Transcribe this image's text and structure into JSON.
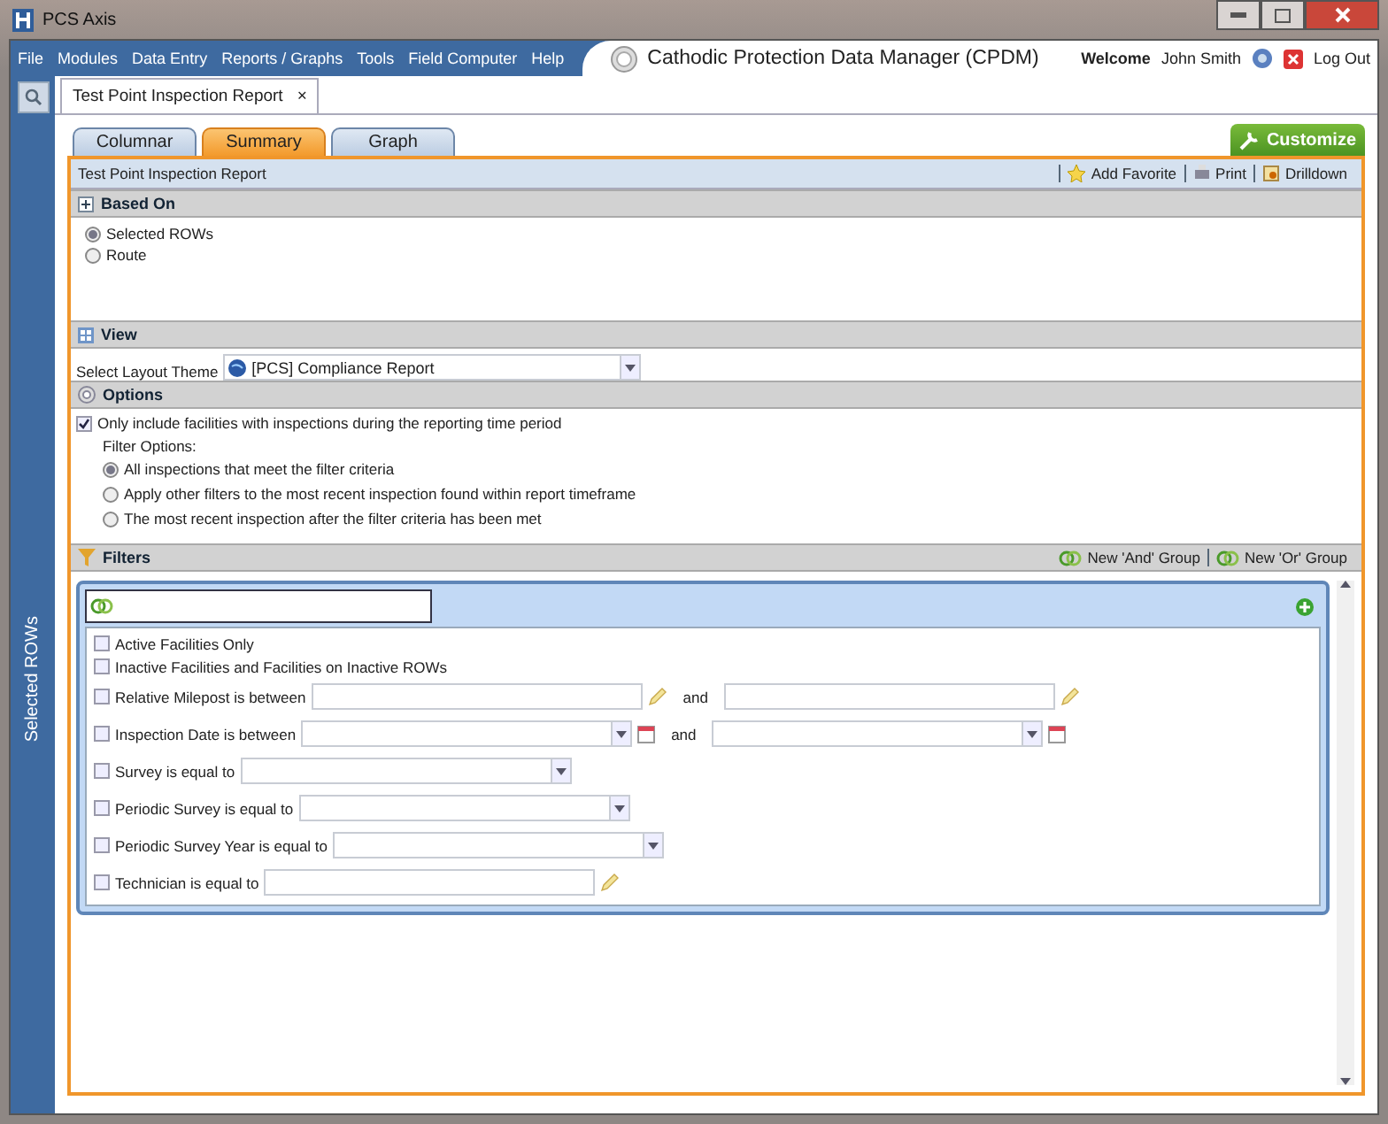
{
  "window": {
    "title": "PCS Axis"
  },
  "menu": [
    "File",
    "Modules",
    "Data Entry",
    "Reports / Graphs",
    "Tools",
    "Field Computer",
    "Help"
  ],
  "app_title": "Cathodic Protection Data Manager (CPDM)",
  "user": {
    "welcome": "Welcome",
    "name": "John Smith",
    "logout": "Log Out"
  },
  "side_panel": {
    "label": "Selected ROWs"
  },
  "doc_tabs": [
    {
      "label": "Test Point Inspection Report",
      "close": "×",
      "selected": true
    }
  ],
  "view_tabs": [
    {
      "label": "Columnar",
      "selected": false
    },
    {
      "label": "Summary",
      "selected": true
    },
    {
      "label": "Graph",
      "selected": false
    }
  ],
  "customize": "Customize",
  "report": {
    "title": "Test Point Inspection Report",
    "actions": [
      "Add Favorite",
      "Print",
      "Drilldown"
    ]
  },
  "based_on": {
    "title": "Based On",
    "options": [
      {
        "label": "Selected ROWs",
        "selected": true
      },
      {
        "label": "Route",
        "selected": false
      }
    ]
  },
  "view": {
    "title": "View",
    "theme_label": "Select Layout Theme",
    "theme_value": "[PCS] Compliance Report"
  },
  "options": {
    "title": "Options",
    "only_include": {
      "label": "Only include facilities with inspections during the reporting time period",
      "checked": true
    },
    "filter_label": "Filter Options:",
    "filter_options": [
      {
        "label": "All inspections that meet the filter criteria",
        "selected": true
      },
      {
        "label": "Apply other filters to the most recent inspection found within report timeframe",
        "selected": false
      },
      {
        "label": "The most recent inspection after the filter criteria has been met",
        "selected": false
      }
    ]
  },
  "filters": {
    "title": "Filters",
    "actions": [
      "New 'And' Group",
      "New 'Or' Group"
    ],
    "rows": [
      {
        "kind": "check",
        "label": "Active Facilities Only",
        "checked": false
      },
      {
        "kind": "check",
        "label": "Inactive Facilities and Facilities on Inactive ROWs",
        "checked": false
      },
      {
        "kind": "text-range",
        "label": "Relative Milepost is between",
        "and": "and",
        "checked": false
      },
      {
        "kind": "date-range",
        "label": "Inspection Date is between",
        "and": "and",
        "checked": false
      },
      {
        "kind": "select",
        "label": "Survey is equal to",
        "checked": false
      },
      {
        "kind": "select",
        "label": "Periodic Survey is equal to",
        "checked": false
      },
      {
        "kind": "select",
        "label": "Periodic Survey Year is equal to",
        "checked": false
      },
      {
        "kind": "text",
        "label": "Technician is equal to",
        "checked": false
      }
    ]
  }
}
